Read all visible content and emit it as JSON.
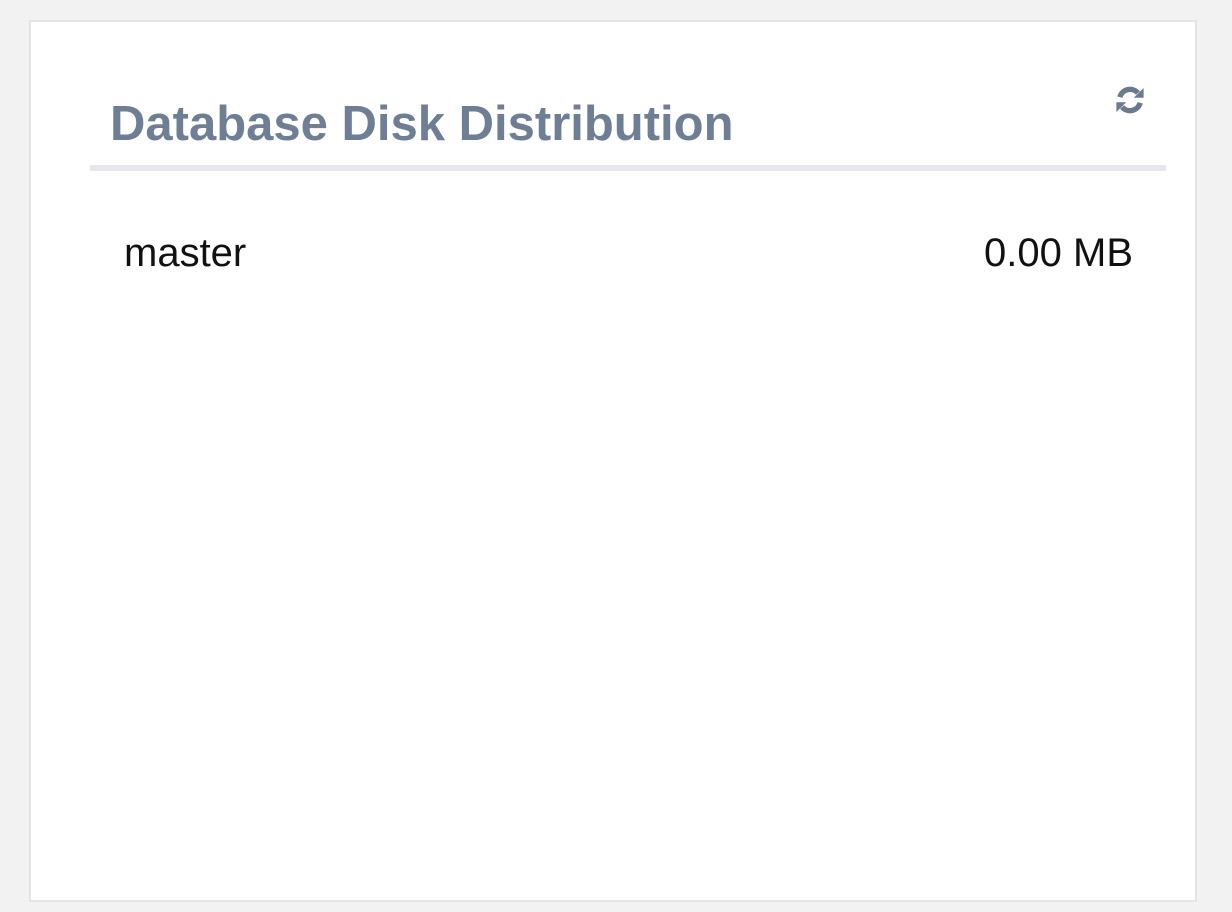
{
  "panel": {
    "title": "Database Disk Distribution",
    "title_color": "#6e7f95",
    "refresh_icon": "refresh-icon",
    "icon_color": "#6b7a8d"
  },
  "databases": [
    {
      "name": "master",
      "size": "0.00 MB"
    }
  ]
}
